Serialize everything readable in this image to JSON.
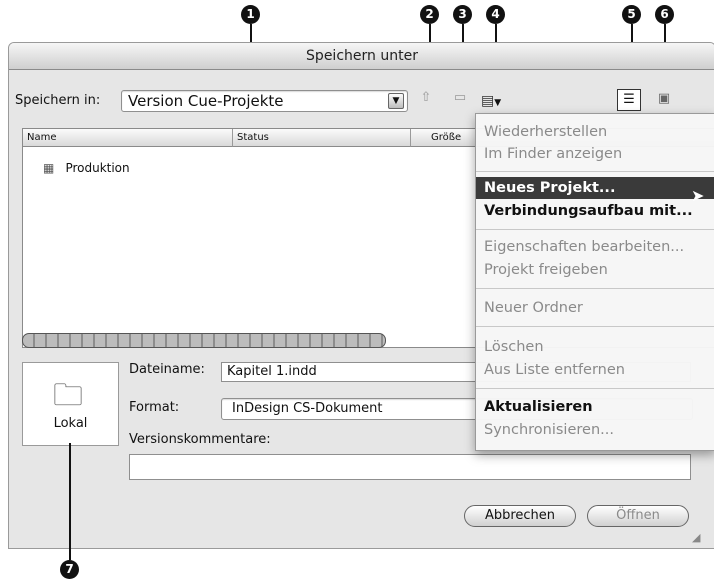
{
  "window": {
    "title": "Speichern unter"
  },
  "location": {
    "label": "Speichern in:",
    "value": "Version Cue-Projekte"
  },
  "list": {
    "columns": [
      "Name",
      "Status",
      "Größe"
    ],
    "items": [
      {
        "name": "Produktion"
      }
    ]
  },
  "sidebar": {
    "lokal_label": "Lokal"
  },
  "form": {
    "filename_label": "Dateiname:",
    "filename_value": "Kapitel 1.indd",
    "format_label": "Format:",
    "format_value": "InDesign CS-Dokument",
    "comments_label": "Versionskommentare:",
    "comments_value": ""
  },
  "buttons": {
    "cancel": "Abbrechen",
    "open": "Öffnen"
  },
  "menu": {
    "items": [
      {
        "label": "Wiederherstellen",
        "state": "disabled"
      },
      {
        "label": "Im Finder anzeigen",
        "state": "disabled"
      },
      {
        "label": "Neues Projekt...",
        "state": "highlighted"
      },
      {
        "label": "Verbindungsaufbau mit...",
        "state": "enabled"
      },
      {
        "label": "Eigenschaften bearbeiten...",
        "state": "disabled"
      },
      {
        "label": "Projekt freigeben",
        "state": "disabled"
      },
      {
        "label": "Neuer Ordner",
        "state": "disabled"
      },
      {
        "label": "Löschen",
        "state": "disabled"
      },
      {
        "label": "Aus Liste entfernen",
        "state": "disabled"
      },
      {
        "label": "Aktualisieren",
        "state": "enabled"
      },
      {
        "label": "Synchronisieren...",
        "state": "disabled"
      }
    ]
  },
  "callouts": [
    "1",
    "2",
    "3",
    "4",
    "5",
    "6",
    "7"
  ]
}
